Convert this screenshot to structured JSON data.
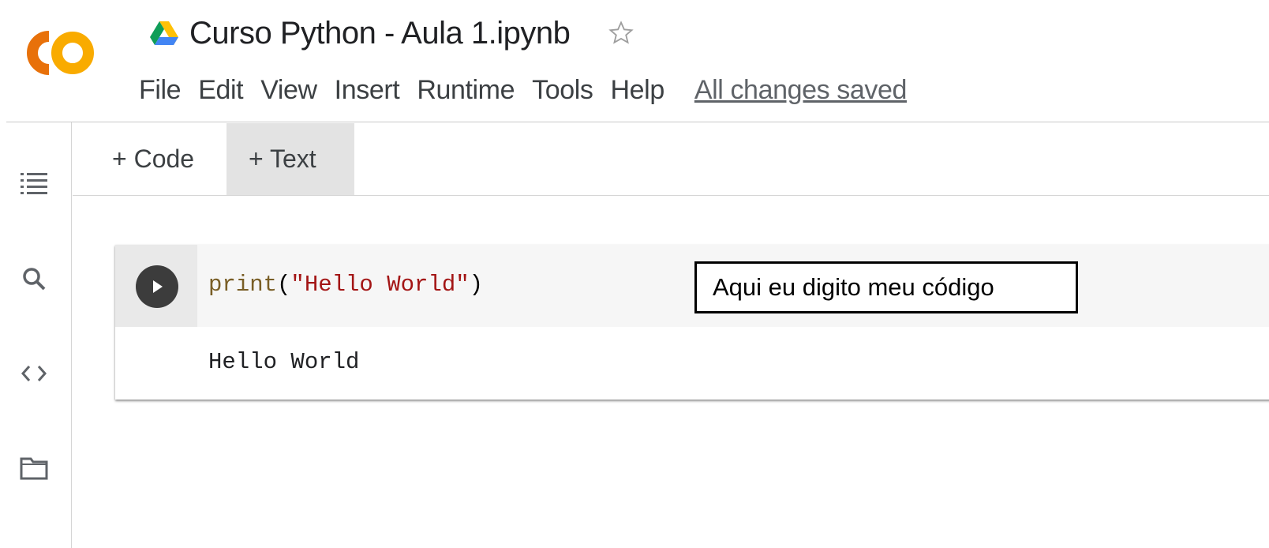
{
  "header": {
    "title": "Curso Python - Aula 1.ipynb",
    "save_status": "All changes saved",
    "icons": {
      "logo": "colab-logo",
      "drive": "drive-icon",
      "star": "star-icon"
    },
    "colors": {
      "logo_orange": "#f9ab00",
      "logo_dark_orange": "#e8710a"
    }
  },
  "menu": {
    "items": [
      {
        "label": "File"
      },
      {
        "label": "Edit"
      },
      {
        "label": "View"
      },
      {
        "label": "Insert"
      },
      {
        "label": "Runtime"
      },
      {
        "label": "Tools"
      },
      {
        "label": "Help"
      }
    ]
  },
  "toolbar": {
    "add_code_label": "+ Code",
    "add_text_label": "+ Text"
  },
  "sidebar": {
    "icons": [
      "table-of-contents-icon",
      "search-icon",
      "code-snippets-icon",
      "files-icon"
    ]
  },
  "cell": {
    "code_fn": "print",
    "code_open": "(",
    "code_string": "\"Hello World\"",
    "code_close": ")",
    "output": "Hello World"
  },
  "annotation": {
    "text": "Aqui eu digito meu código"
  }
}
